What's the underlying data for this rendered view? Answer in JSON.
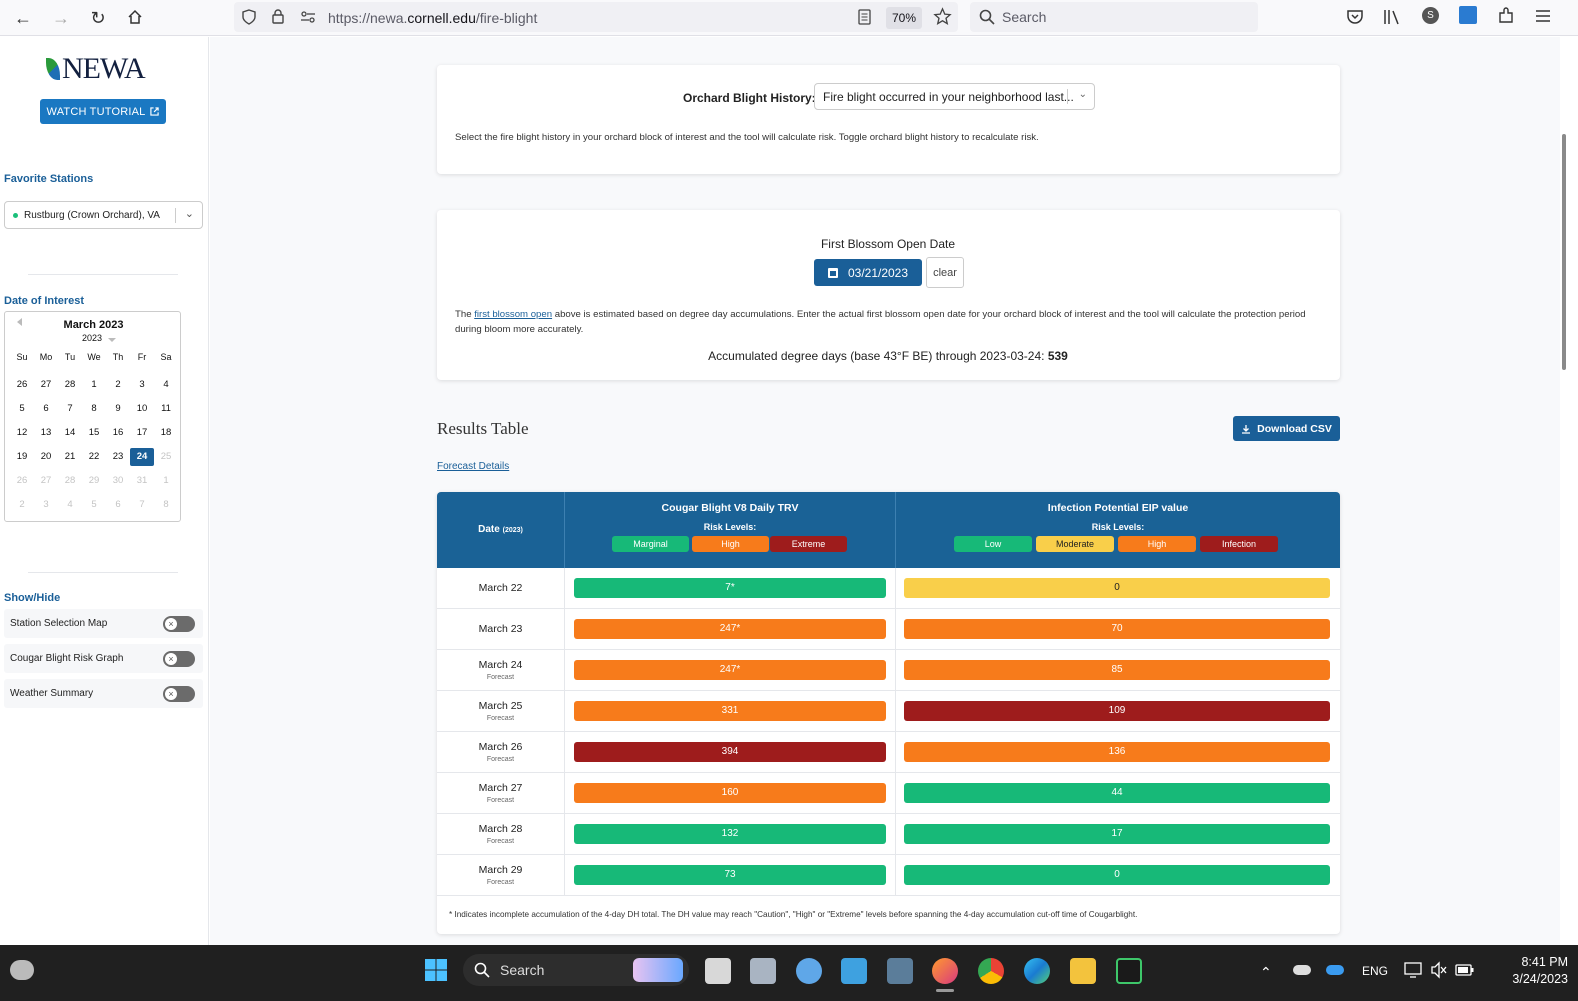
{
  "browser": {
    "url_prefix": "https://newa.",
    "url_domain": "cornell.edu",
    "url_path": "/fire-blight",
    "zoom": "70%",
    "search_placeholder": "Search"
  },
  "sidebar": {
    "logo": "NEWA",
    "tutorial_label": "WATCH TUTORIAL",
    "favorite_heading": "Favorite Stations",
    "station": "Rustburg (Crown Orchard), VA",
    "date_heading": "Date of Interest",
    "calendar": {
      "month": "March 2023",
      "year": "2023",
      "weekdays": [
        "Su",
        "Mo",
        "Tu",
        "We",
        "Th",
        "Fr",
        "Sa"
      ],
      "weeks": [
        [
          "26",
          "27",
          "28",
          "1",
          "2",
          "3",
          "4"
        ],
        [
          "5",
          "6",
          "7",
          "8",
          "9",
          "10",
          "11"
        ],
        [
          "12",
          "13",
          "14",
          "15",
          "16",
          "17",
          "18"
        ],
        [
          "19",
          "20",
          "21",
          "22",
          "23",
          "24",
          "25"
        ],
        [
          "26",
          "27",
          "28",
          "29",
          "30",
          "31",
          "1"
        ],
        [
          "2",
          "3",
          "4",
          "5",
          "6",
          "7",
          "8"
        ]
      ],
      "selected": "24"
    },
    "showhide_heading": "Show/Hide",
    "toggles": [
      "Station Selection Map",
      "Cougar Blight Risk Graph",
      "Weather Summary"
    ]
  },
  "history": {
    "label": "Orchard Blight History:",
    "value": "Fire blight occurred in your neighborhood last...",
    "note": "Select the fire blight history in your orchard block of interest and the tool will calculate risk. Toggle orchard blight history to recalculate risk."
  },
  "blossom": {
    "title": "First Blossom Open Date",
    "date": "03/21/2023",
    "clear": "clear",
    "note_pre": "The ",
    "note_link": "first blossom open",
    "note_post": " above is estimated based on degree day accumulations. Enter the actual first blossom open date for your orchard block of interest and the tool will calculate the protection period during bloom more accurately.",
    "accum_text": "Accumulated degree days (base 43°F BE) through 2023-03-24: ",
    "accum_value": "539"
  },
  "results": {
    "title": "Results Table",
    "csv_label": "Download CSV",
    "forecast_link": "Forecast Details",
    "date_header": "Date",
    "date_header_year": "(2023)",
    "cougar_header": "Cougar Blight V8 Daily TRV",
    "eip_header": "Infection Potential EIP value",
    "risk_levels_label": "Risk Levels:",
    "cougar_levels": [
      {
        "label": "Marginal",
        "color": "#17b978"
      },
      {
        "label": "High",
        "color": "#f77b1b"
      },
      {
        "label": "Extreme",
        "color": "#9e1c1c"
      }
    ],
    "eip_levels": [
      {
        "label": "Low",
        "color": "#17b978"
      },
      {
        "label": "Moderate",
        "color": "#f9cf4a"
      },
      {
        "label": "High",
        "color": "#f77b1b"
      },
      {
        "label": "Infection",
        "color": "#9e1c1c"
      }
    ],
    "rows": [
      {
        "date": "March 22",
        "sub": "",
        "trv": "7*",
        "trv_level": "Marginal",
        "eip": "0",
        "eip_level": "Moderate"
      },
      {
        "date": "March 23",
        "sub": "",
        "trv": "247*",
        "trv_level": "High",
        "eip": "70",
        "eip_level": "High"
      },
      {
        "date": "March 24",
        "sub": "Forecast",
        "trv": "247*",
        "trv_level": "High",
        "eip": "85",
        "eip_level": "High"
      },
      {
        "date": "March 25",
        "sub": "Forecast",
        "trv": "331",
        "trv_level": "High",
        "eip": "109",
        "eip_level": "Infection"
      },
      {
        "date": "March 26",
        "sub": "Forecast",
        "trv": "394",
        "trv_level": "Extreme",
        "eip": "136",
        "eip_level": "High"
      },
      {
        "date": "March 27",
        "sub": "Forecast",
        "trv": "160",
        "trv_level": "High",
        "eip": "44",
        "eip_level": "Low"
      },
      {
        "date": "March 28",
        "sub": "Forecast",
        "trv": "132",
        "trv_level": "Marginal",
        "eip": "17",
        "eip_level": "Low"
      },
      {
        "date": "March 29",
        "sub": "Forecast",
        "trv": "73",
        "trv_level": "Marginal",
        "eip": "0",
        "eip_level": "Low"
      }
    ],
    "footnote": "* Indicates incomplete accumulation of the 4-day DH total. The DH value may reach \"Caution\", \"High\" or \"Extreme\" levels before spanning the 4-day accumulation cut-off time of Cougarblight."
  },
  "taskbar": {
    "search": "Search",
    "lang": "ENG",
    "time": "8:41 PM",
    "date": "3/24/2023"
  }
}
